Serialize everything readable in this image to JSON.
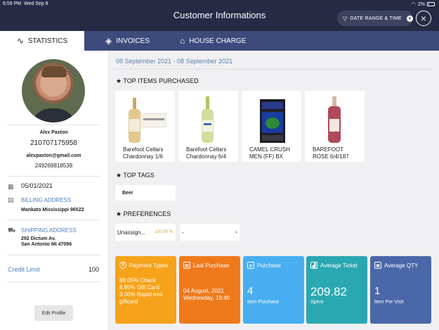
{
  "status_bar": {
    "time": "6:59 PM",
    "date": "Wed Sep 8",
    "battery": "2%"
  },
  "header": {
    "title": "Customer Informations",
    "date_range_label": "DATE RANGE & TIME"
  },
  "tabs": [
    {
      "label": "STATISTICS",
      "icon": "chart-icon"
    },
    {
      "label": "INVOICES",
      "icon": "layers-icon"
    },
    {
      "label": "HOUSE CHARGE",
      "icon": "house-icon"
    }
  ],
  "customer": {
    "name": "Alex Paxton",
    "phone": "210707175958",
    "email": "alexpaxton@gmail.com",
    "phone2": "249269818538",
    "dob": "05/01/2021",
    "billing_label": "BILLING ADDRESS",
    "billing_address": "Mankato Mississippi 96522",
    "shipping_label": "SHIPPING ADDRESS",
    "shipping_line1": "292 Dictum Av.",
    "shipping_line2": "San Antonio MI 47096",
    "credit_label": "Credit Limit",
    "credit_value": "100",
    "edit_label": "Edit Profile"
  },
  "main": {
    "date_range": "08 September 2021 - 08 September 2021",
    "top_items_title": "TOP ITEMS PURCHASED",
    "items": [
      {
        "line1": "Barefoot Cellars",
        "line2": "Chardonnay 1/6"
      },
      {
        "line1": "Barefoot Cellars",
        "line2": "Chardonnay 6/4"
      },
      {
        "line1": "CAMEL CRUSH",
        "line2": "MEN (FF) BX"
      },
      {
        "line1": "BAREFOOT",
        "line2": "ROSE 6/4/187"
      }
    ],
    "top_tags_title": "TOP TAGS",
    "tag": "Beer",
    "preferences_title": "PREFERENCES",
    "pref1_label": "Unassign...",
    "pref1_pct": "100.00 %",
    "pref2_label": "-"
  },
  "stats": [
    {
      "title": "Payment Types",
      "lines": [
        "88.05% Check",
        "8.95% Gift Card",
        "3.00% Rapid rms",
        "giftcard"
      ],
      "color": "#f6a21b"
    },
    {
      "title": "Last Purchase",
      "lines": [
        "04 August, 2021",
        "Wednesday, 19:40"
      ],
      "color": "#ef7a1c"
    },
    {
      "title": "Purchase",
      "value": "4",
      "sub": "Item Purchase",
      "color": "#48aef0"
    },
    {
      "title": "Average Ticket",
      "value": "209.82",
      "sub": "Spent",
      "color": "#2aa8b1"
    },
    {
      "title": "Average QTY",
      "value": "1",
      "sub": "Item Per Visit",
      "color": "#4a67a8"
    }
  ]
}
